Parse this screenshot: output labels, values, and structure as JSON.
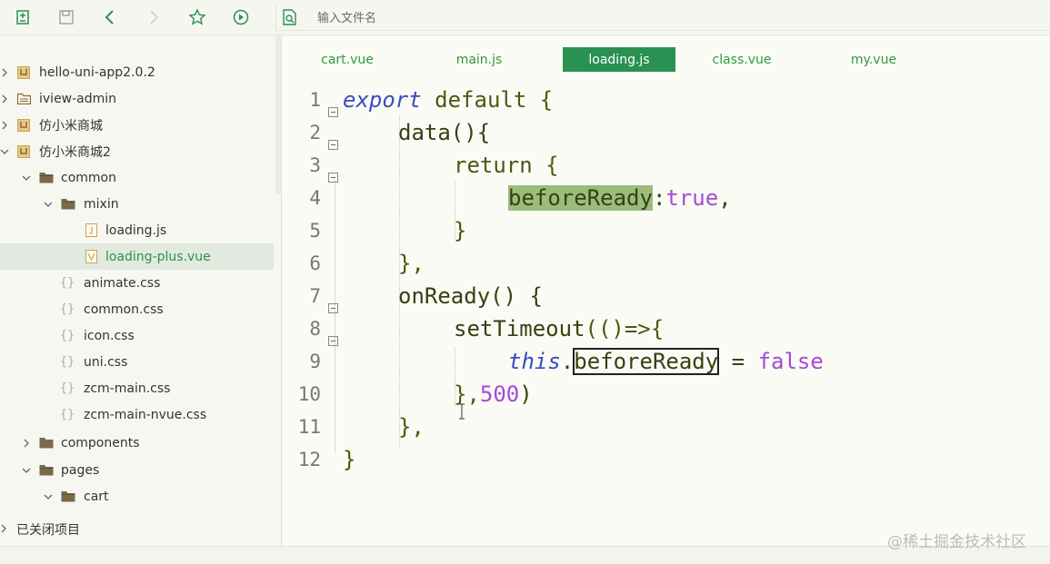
{
  "toolbar": {
    "icons": [
      "new-file-icon",
      "save-icon",
      "back-icon",
      "forward-icon",
      "star-icon",
      "run-icon",
      "search-file-icon"
    ],
    "search_placeholder": "输入文件名"
  },
  "sidebar": {
    "items": [
      {
        "label": "hello-uni-app2.0.2",
        "type": "project"
      },
      {
        "label": "iview-admin",
        "type": "folder"
      },
      {
        "label": "仿小米商城",
        "type": "project"
      },
      {
        "label": "仿小米商城2",
        "type": "project"
      },
      {
        "label": "common",
        "type": "folder"
      },
      {
        "label": "mixin",
        "type": "folder"
      },
      {
        "label": "loading.js",
        "type": "js"
      },
      {
        "label": "loading-plus.vue",
        "type": "vue"
      },
      {
        "label": "animate.css",
        "type": "css"
      },
      {
        "label": "common.css",
        "type": "css"
      },
      {
        "label": "icon.css",
        "type": "css"
      },
      {
        "label": "uni.css",
        "type": "css"
      },
      {
        "label": "zcm-main.css",
        "type": "css"
      },
      {
        "label": "zcm-main-nvue.css",
        "type": "css"
      },
      {
        "label": "components",
        "type": "folder"
      },
      {
        "label": "pages",
        "type": "folder"
      },
      {
        "label": "cart",
        "type": "folder"
      }
    ],
    "closed_label": "已关闭项目"
  },
  "tabs": [
    {
      "label": "cart.vue"
    },
    {
      "label": "main.js"
    },
    {
      "label": "loading.js"
    },
    {
      "label": "class.vue"
    },
    {
      "label": "my.vue"
    }
  ],
  "active_tab": "loading.js",
  "editor": {
    "line_numbers": [
      "1",
      "2",
      "3",
      "4",
      "5",
      "6",
      "7",
      "8",
      "9",
      "10",
      "11",
      "12"
    ],
    "tokens": {
      "export": "export",
      "default": "default",
      "brace_open": "{",
      "data": "data(){",
      "return": "return",
      "beforeReady": "beforeReady",
      "colon_true": ":true,",
      "true": "true",
      "brace_close": "}",
      "brace_close_comma": "},",
      "onReady": "onReady() {",
      "setTimeout": "setTimeout",
      "arrow": "(()=>{",
      "this": "this",
      "dot": ".",
      "eq": " = ",
      "false": "false",
      "close_timeout": "},",
      "num500": "500",
      "paren_close": ")"
    }
  },
  "watermark": "@稀土掘金技术社区",
  "colors": {
    "accent": "#2a9152",
    "tab_text": "#2f9a3c",
    "highlight": "#9cbc7e",
    "value": "#a44bd6",
    "keyword_italic": "#3a4cc0"
  }
}
